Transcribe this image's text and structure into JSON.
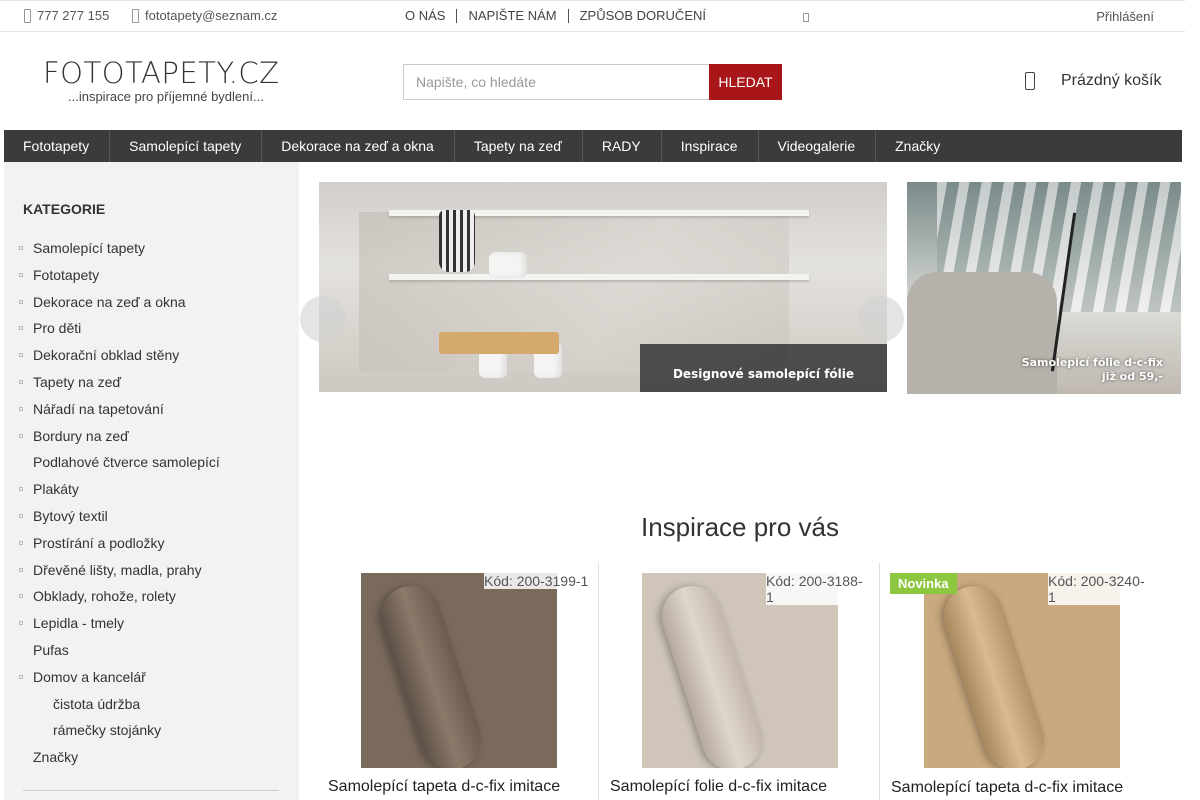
{
  "topbar": {
    "phone": "777 277 155",
    "email": "fototapety@seznam.cz",
    "links": [
      "O NÁS",
      "NAPIŠTE NÁM",
      "ZPŮSOB DORUČENÍ"
    ],
    "login": "Přihlášení"
  },
  "header": {
    "logo_main": "FOTOTAPETY.CZ",
    "logo_sub": "...inspirace pro příjemné bydlení...",
    "search_placeholder": "Napište, co hledáte",
    "search_button": "HLEDAT",
    "cart_label": "Prázdný košík"
  },
  "mainnav": [
    "Fototapety",
    "Samolepící tapety",
    "Dekorace na zeď a okna",
    "Tapety na zeď",
    "RADY",
    "Inspirace",
    "Videogalerie",
    "Značky"
  ],
  "sidebar": {
    "title": "KATEGORIE",
    "items": [
      "Samolepící tapety",
      "Fototapety",
      "Dekorace na zeď a okna",
      "Pro děti",
      "Dekorační obklad stěny",
      "Tapety na zeď",
      "Nářadí na tapetování",
      "Bordury na zeď",
      "Podlahové čtverce samolepící",
      "Plakáty",
      "Bytový textil",
      "Prostírání a podložky",
      "Dřevěné lišty, madla, prahy",
      "Obklady, rohože, rolety",
      "Lepidla - tmely",
      "Pufas",
      "Domov a kancelář",
      "čistota údržba",
      "rámečky stojánky",
      "Značky"
    ]
  },
  "banners": {
    "main_caption": "Designové samolepící fólie",
    "side_caption_line1": "Samolepicí fólie d-c-fix",
    "side_caption_line2": "již od 59,-"
  },
  "inspiration": {
    "title": "Inspirace pro vás",
    "products": [
      {
        "code": "Kód: 200-3199-1",
        "name": "Samolepící tapeta d-c-fix imitace",
        "badge": "",
        "color": "#7a6a5c"
      },
      {
        "code": "Kód: 200-3188-1",
        "name": "Samolepící folie d-c-fix imitace",
        "badge": "",
        "color": "#cfc5b9"
      },
      {
        "code": "Kód: 200-3240-1",
        "name": "Samolepící tapeta d-c-fix imitace",
        "badge": "Novinka",
        "color": "#c9a97e"
      }
    ]
  },
  "colors": {
    "accent": "#a8161a",
    "nav_bg": "#3b3b3b",
    "badge": "#8dc63f"
  }
}
